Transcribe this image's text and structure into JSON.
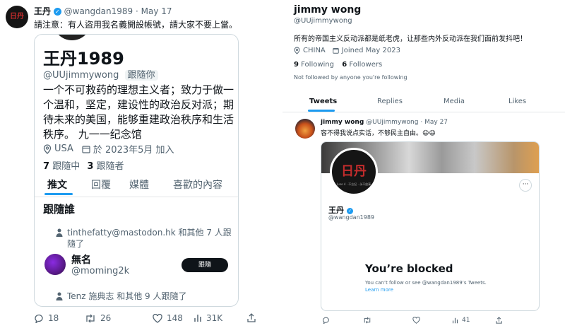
{
  "left_tweet": {
    "display_name": "王丹",
    "handle": "@wangdan1989",
    "sep": "·",
    "date": "May 17",
    "text": "請注意：有人盜用我名義開設帳號，請大家不要上當。",
    "avatar_glyph": "日丹",
    "actions": {
      "replies": "18",
      "retweets": "26",
      "likes": "148",
      "views": "31K"
    }
  },
  "left_card": {
    "name": "王丹1989",
    "handle": "@UUjimmywong",
    "follows_you": "跟隨你",
    "bio": "一个不可救药的理想主义者；致力于做一个温和，坚定，建设性的政治反对派；期待未来的美国，能够重建政治秩序和生活秩序。 九一一纪念馆",
    "location": "USA",
    "joined": "於 2023年5月 加入",
    "following_count": "7",
    "following_label": "跟隨中",
    "followers_count": "3",
    "followers_label": "跟隨者",
    "tabs": [
      "推文",
      "回覆",
      "媒體",
      "喜歡的內容"
    ],
    "who_to_follow_title": "跟隨誰",
    "suggestion1_context": "tinthefatty@mastodon.hk 和其他 7 人跟隨了",
    "suggestion2_name": "無名",
    "suggestion2_handle": "@moming2k",
    "follow_button": "跟隨",
    "suggestion3_context": "Tenz 施典志 和其他 9 人跟隨了"
  },
  "right_profile": {
    "name": "jimmy wong",
    "handle": "@UUjimmywong",
    "bio": "所有的帝国主义反动派都是纸老虎，让那些内外反动派在我们面前发抖吧！",
    "location": "CHINA",
    "joined": "Joined May 2023",
    "following_count": "9",
    "following_label": "Following",
    "followers_count": "6",
    "followers_label": "Followers",
    "not_followed": "Not followed by anyone you're following",
    "tabs": [
      "Tweets",
      "Replies",
      "Media",
      "Likes"
    ]
  },
  "right_tweet": {
    "display_name": "jimmy wong",
    "handle": "@UUjimmywong",
    "sep": "·",
    "date": "May 27",
    "text": "容不得我说点实话，不够民主自由。😃😃",
    "card": {
      "avatar_glyph": "日丹",
      "avatar_caption": "June 4 · 不忘記 · 永不放棄",
      "name": "王丹",
      "handle": "@wangdan1989",
      "more": "···",
      "blocked_title": "You’re blocked",
      "blocked_desc": "You can’t follow or see @wangdan1989’s Tweets.",
      "learn_more": "Learn more"
    },
    "actions": {
      "views": "41"
    }
  },
  "colors": {
    "accent": "#1d9bf0",
    "text": "#0f1419",
    "muted": "#536471",
    "border": "#cfd9de",
    "logo_red": "#c22c2c"
  }
}
